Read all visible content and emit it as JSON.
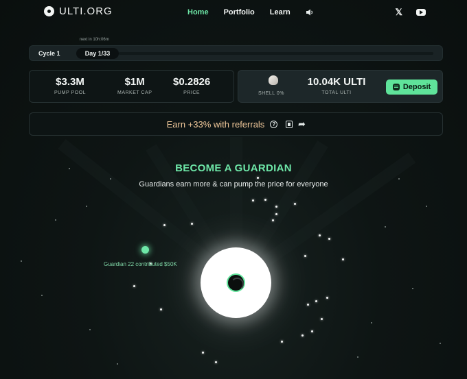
{
  "header": {
    "logo_text": "ULTI.ORG",
    "nav": [
      {
        "label": "Home",
        "active": true
      },
      {
        "label": "Portfolio",
        "active": false
      },
      {
        "label": "Learn",
        "active": false
      }
    ]
  },
  "cycle": {
    "next_in": "next in 10h:06m",
    "cycle_label": "Cycle 1",
    "day_label": "Day 1/33",
    "progress": 0.0
  },
  "stats": {
    "pump_pool": {
      "value": "$3.3M",
      "label": "PUMP POOL"
    },
    "market_cap": {
      "value": "$1M",
      "label": "MARKET CAP"
    },
    "price": {
      "value": "$0.2826",
      "label": "PRICE"
    },
    "shell": {
      "label": "SHELL 0%"
    },
    "total_ulti": {
      "value": "10.04K ULTI",
      "label": "TOTAL ULTI"
    },
    "deposit_label": "Deposit"
  },
  "referral": {
    "text": "Earn +33% with referrals"
  },
  "guardian": {
    "title": "BECOME A GUARDIAN",
    "subtitle": "Guardians earn more & can pump the price for everyone",
    "event_label": "Guardian 22 contributed $50K"
  },
  "colors": {
    "accent": "#6ee7a8",
    "deposit_bg": "#5fe39a",
    "referral_text": "#f0c89a",
    "background": "#0c1211"
  },
  "icons": [
    "logo-icon",
    "sound-icon",
    "x-icon",
    "youtube-icon",
    "shell-icon",
    "coins-icon",
    "help-icon",
    "copy-icon",
    "share-icon"
  ]
}
